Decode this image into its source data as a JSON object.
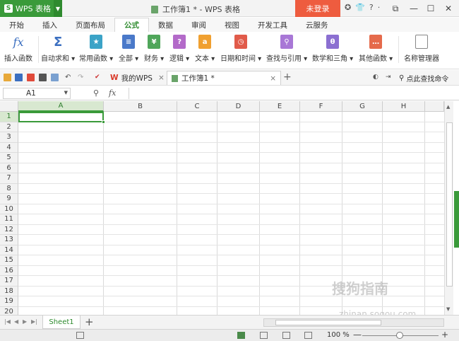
{
  "titlebar": {
    "app_name": "WPS 表格",
    "doc_title": "工作簿1 * - WPS 表格",
    "login_label": "未登录",
    "help_label": "?"
  },
  "menu": {
    "tabs": [
      "开始",
      "插入",
      "页面布局",
      "公式",
      "数据",
      "审阅",
      "视图",
      "开发工具",
      "云服务"
    ],
    "active_index": 3
  },
  "ribbon": {
    "insert_function": "插入函数",
    "autosum": "自动求和",
    "common_functions": "常用函数",
    "all": "全部",
    "financial": "财务",
    "logical": "逻辑",
    "text": "文本",
    "datetime": "日期和时间",
    "lookup": "查找与引用",
    "math": "数学和三角",
    "other": "其他函数",
    "name_manager": "名称管理器",
    "fx_symbol": "fx",
    "sigma_symbol": "Σ"
  },
  "quickbar": {
    "my_wps": "我的WPS",
    "doc_tab": "工作簿1 *",
    "find_command": "点此查找命令"
  },
  "formula_bar": {
    "name_box": "A1",
    "fx_label": "fx",
    "formula_value": ""
  },
  "grid": {
    "columns": [
      "A",
      "B",
      "C",
      "D",
      "E",
      "F",
      "G",
      "H"
    ],
    "rows": [
      "1",
      "2",
      "3",
      "4",
      "5",
      "6",
      "7",
      "8",
      "9",
      "10",
      "11",
      "12",
      "13",
      "14",
      "15",
      "16",
      "17",
      "18",
      "19",
      "20"
    ],
    "selected_cell": "A1"
  },
  "sheets": {
    "tabs": [
      "Sheet1"
    ],
    "active": "Sheet1"
  },
  "status": {
    "zoom": "100 %"
  },
  "watermark": {
    "text": "搜狗指南",
    "url": "zhinan.sogou.com"
  },
  "colors": {
    "brand_green": "#3a9a3a",
    "login_orange": "#ee5c3f"
  }
}
